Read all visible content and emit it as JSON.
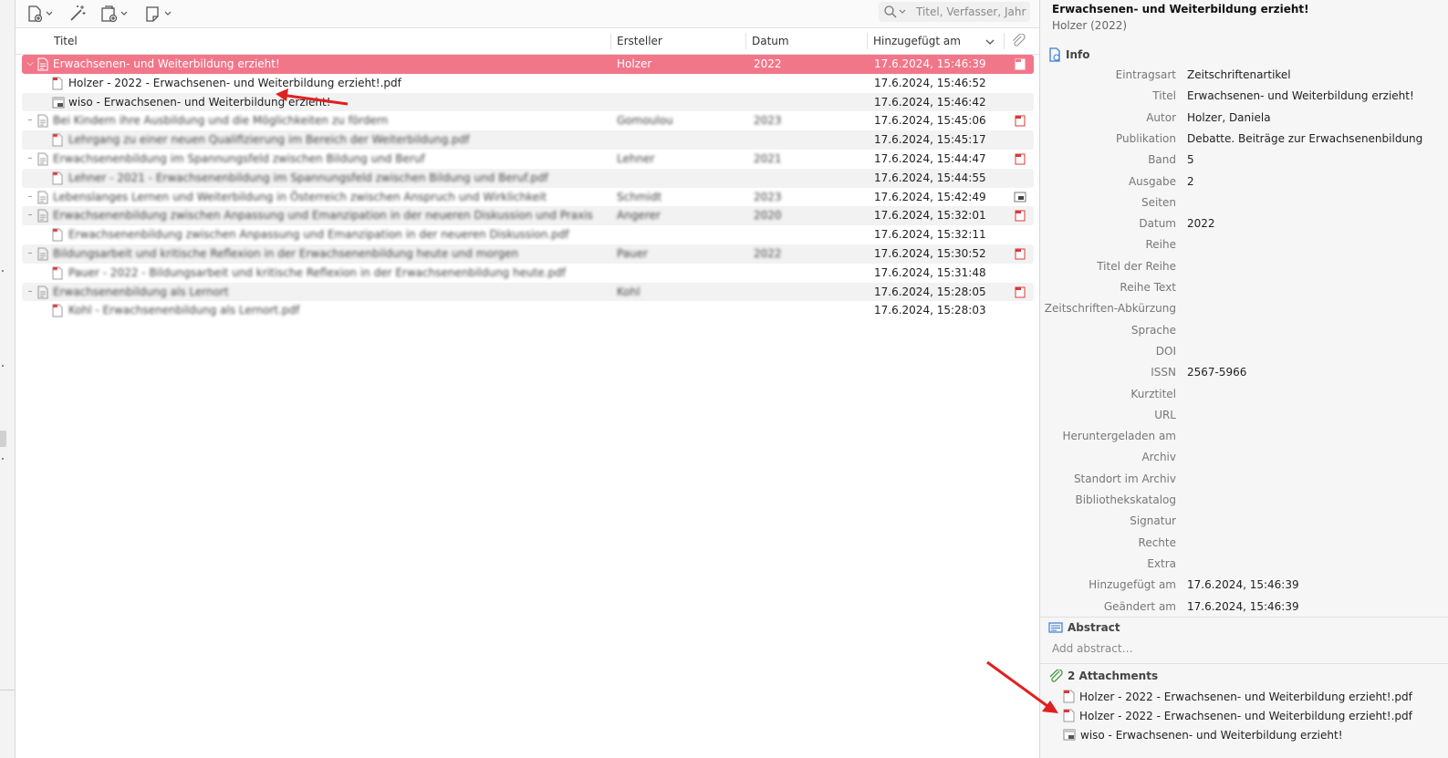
{
  "toolbar": {
    "search_placeholder": "Titel, Verfasser, Jahr"
  },
  "columns": {
    "title": "Titel",
    "creator": "Ersteller",
    "date": "Datum",
    "added": "Hinzugefügt am"
  },
  "rows": [
    {
      "title": "Erwachsenen- und Weiterbildung erzieht!",
      "creator": "Holzer",
      "date": "2022",
      "added": "17.6.2024, 15:46:39",
      "kind": "parent",
      "selected": true,
      "blurred": false,
      "attachment": "pdf"
    },
    {
      "title": "Holzer - 2022 - Erwachsenen- und Weiterbildung erzieht!.pdf",
      "creator": "",
      "date": "",
      "added": "17.6.2024, 15:46:52",
      "kind": "child-pdf",
      "blurred": false
    },
    {
      "title": "wiso - Erwachsenen- und Weiterbildung erzieht!",
      "creator": "",
      "date": "",
      "added": "17.6.2024, 15:46:42",
      "kind": "child-web",
      "blurred": false
    },
    {
      "title": "Bei Kindern ihre Ausbildung und die Möglichkeiten zu fördern",
      "creator": "Gomoulou",
      "date": "2023",
      "added": "17.6.2024, 15:45:06",
      "kind": "parent",
      "blurred": true,
      "attachment": "pdf"
    },
    {
      "title": "Lehrgang zu einer neuen Qualifizierung im Bereich der Weiterbildung.pdf",
      "creator": "",
      "date": "",
      "added": "17.6.2024, 15:45:17",
      "kind": "child-pdf",
      "blurred": true
    },
    {
      "title": "Erwachsenenbildung im Spannungsfeld zwischen Bildung und Beruf",
      "creator": "Lehner",
      "date": "2021",
      "added": "17.6.2024, 15:44:47",
      "kind": "parent",
      "blurred": true,
      "attachment": "pdf"
    },
    {
      "title": "Lehner - 2021 - Erwachsenenbildung im Spannungsfeld zwischen Bildung und Beruf.pdf",
      "creator": "",
      "date": "",
      "added": "17.6.2024, 15:44:55",
      "kind": "child-pdf",
      "blurred": true
    },
    {
      "title": "Lebenslanges Lernen und Weiterbildung in Österreich zwischen Anspruch und Wirklichkeit",
      "creator": "Schmidt",
      "date": "2023",
      "added": "17.6.2024, 15:42:49",
      "kind": "parent",
      "blurred": true,
      "attachment": "web"
    },
    {
      "title": "Erwachsenenbildung zwischen Anpassung und Emanzipation in der neueren Diskussion und Praxis",
      "creator": "Angerer",
      "date": "2020",
      "added": "17.6.2024, 15:32:01",
      "kind": "parent",
      "blurred": true,
      "attachment": "pdf"
    },
    {
      "title": "Erwachsenenbildung zwischen Anpassung und Emanzipation in der neueren Diskussion.pdf",
      "creator": "",
      "date": "",
      "added": "17.6.2024, 15:32:11",
      "kind": "child-pdf",
      "blurred": true
    },
    {
      "title": "Bildungsarbeit und kritische Reflexion in der Erwachsenenbildung heute und morgen",
      "creator": "Pauer",
      "date": "2022",
      "added": "17.6.2024, 15:30:52",
      "kind": "parent",
      "blurred": true,
      "attachment": "pdf"
    },
    {
      "title": "Pauer - 2022 - Bildungsarbeit und kritische Reflexion in der Erwachsenenbildung heute.pdf",
      "creator": "",
      "date": "",
      "added": "17.6.2024, 15:31:48",
      "kind": "child-pdf",
      "blurred": true
    },
    {
      "title": "Erwachsenenbildung als Lernort",
      "creator": "Kohl",
      "date": "",
      "added": "17.6.2024, 15:28:05",
      "kind": "parent",
      "blurred": true,
      "attachment": "pdf"
    },
    {
      "title": "Kohl - Erwachsenenbildung als Lernort.pdf",
      "creator": "",
      "date": "",
      "added": "17.6.2024, 15:28:03",
      "kind": "child-pdf",
      "blurred": true
    }
  ],
  "details": {
    "title": "Erwachsenen- und Weiterbildung erzieht!",
    "subtitle": "Holzer (2022)",
    "info_heading": "Info",
    "fields": [
      {
        "label": "Eintragsart",
        "value": "Zeitschriftenartikel"
      },
      {
        "label": "Titel",
        "value": "Erwachsenen- und Weiterbildung erzieht!"
      },
      {
        "label": "Autor",
        "value": "Holzer, Daniela"
      },
      {
        "label": "Publikation",
        "value": "Debatte. Beiträge zur Erwachsenenbildung"
      },
      {
        "label": "Band",
        "value": "5"
      },
      {
        "label": "Ausgabe",
        "value": "2"
      },
      {
        "label": "Seiten",
        "value": ""
      },
      {
        "label": "Datum",
        "value": "2022"
      },
      {
        "label": "Reihe",
        "value": ""
      },
      {
        "label": "Titel der Reihe",
        "value": ""
      },
      {
        "label": "Reihe Text",
        "value": ""
      },
      {
        "label": "Zeitschriften-Abkürzung",
        "value": ""
      },
      {
        "label": "Sprache",
        "value": ""
      },
      {
        "label": "DOI",
        "value": ""
      },
      {
        "label": "ISSN",
        "value": "2567-5966"
      },
      {
        "label": "Kurztitel",
        "value": ""
      },
      {
        "label": "URL",
        "value": ""
      },
      {
        "label": "Heruntergeladen am",
        "value": ""
      },
      {
        "label": "Archiv",
        "value": ""
      },
      {
        "label": "Standort im Archiv",
        "value": ""
      },
      {
        "label": "Bibliothekskatalog",
        "value": ""
      },
      {
        "label": "Signatur",
        "value": ""
      },
      {
        "label": "Rechte",
        "value": ""
      },
      {
        "label": "Extra",
        "value": ""
      },
      {
        "label": "Hinzugefügt am",
        "value": "17.6.2024, 15:46:39"
      },
      {
        "label": "Geändert am",
        "value": "17.6.2024, 15:46:39"
      }
    ],
    "abstract_heading": "Abstract",
    "abstract_placeholder": "Add abstract…",
    "attachments_heading": "2 Attachments",
    "attachments": [
      {
        "name": "Holzer - 2022 - Erwachsenen- und Weiterbildung erzieht!.pdf",
        "type": "pdf"
      },
      {
        "name": "Holzer - 2022 - Erwachsenen- und Weiterbildung erzieht!.pdf",
        "type": "pdf"
      },
      {
        "name": "wiso - Erwachsenen- und Weiterbildung erzieht!",
        "type": "web"
      }
    ]
  },
  "colors": {
    "selection": "#f2768a",
    "annotation_arrow": "#e02020",
    "pdf_red": "#d9383a",
    "accent_blue": "#3a7bd5"
  }
}
